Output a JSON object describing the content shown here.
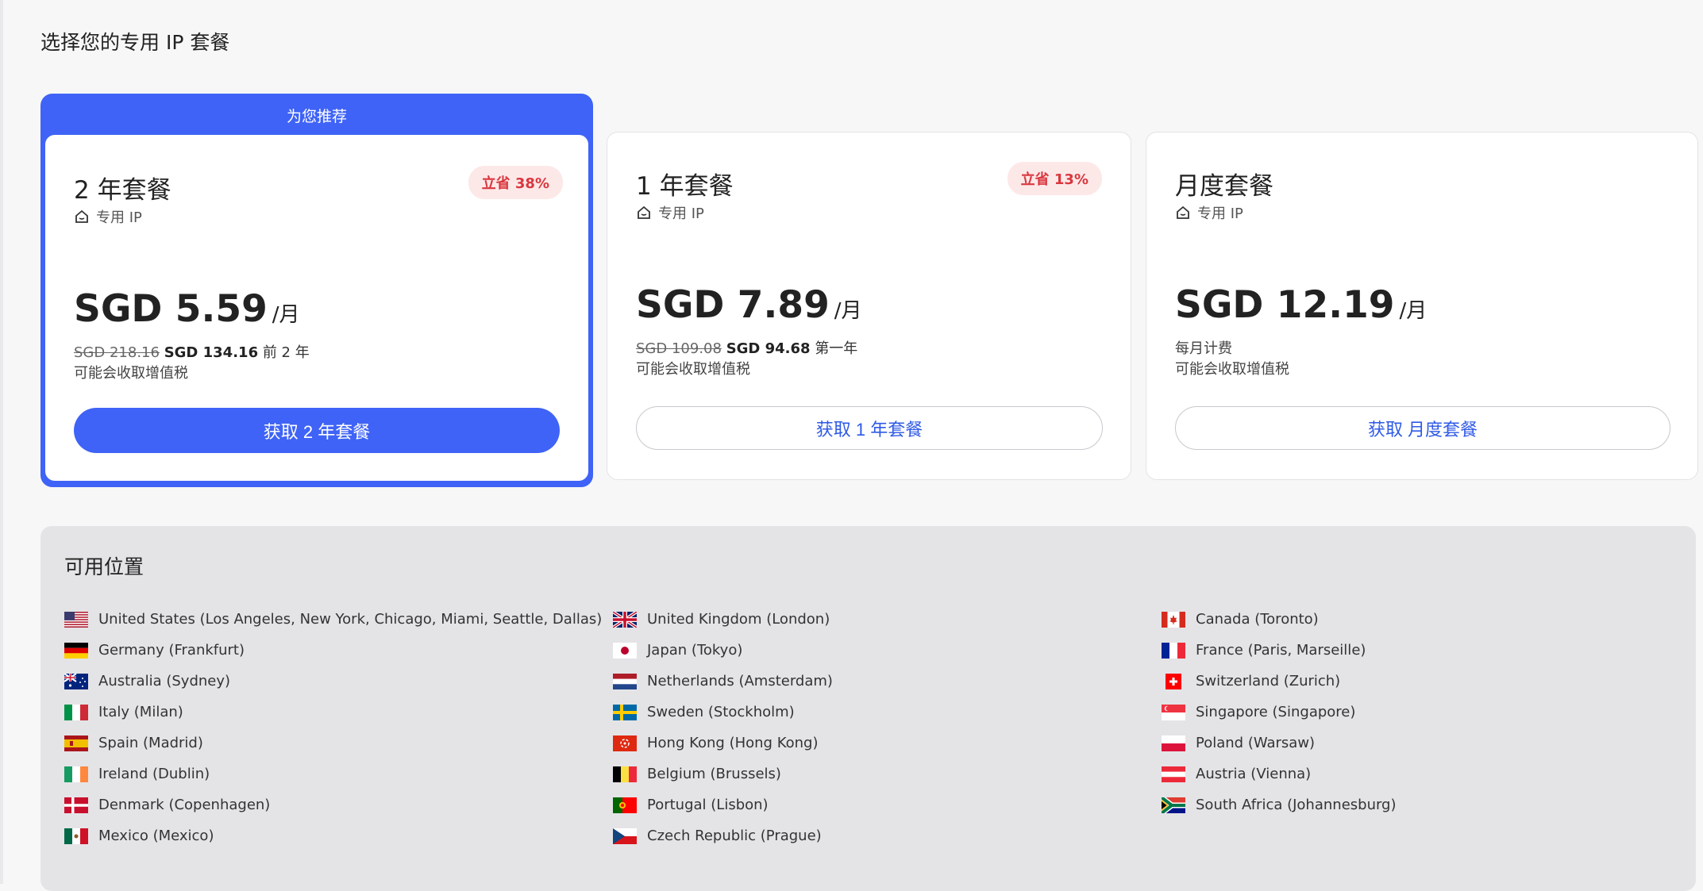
{
  "page": {
    "title": "选择您的专用 IP 套餐"
  },
  "plans": [
    {
      "recommended_label": "为您推荐",
      "name": "2 年套餐",
      "sub": "专用 IP",
      "badge": "立省 38%",
      "price": "SGD 5.59",
      "unit": "/月",
      "old_price": "SGD 218.16",
      "new_price": "SGD 134.16",
      "period_text": "前 2 年",
      "tax_note": "可能会收取增值税",
      "button": "获取 2 年套餐"
    },
    {
      "name": "1 年套餐",
      "sub": "专用 IP",
      "badge": "立省 13%",
      "price": "SGD 7.89",
      "unit": "/月",
      "old_price": "SGD 109.08",
      "new_price": "SGD 94.68",
      "period_text": "第一年",
      "tax_note": "可能会收取增值税",
      "button": "获取 1 年套餐"
    },
    {
      "name": "月度套餐",
      "sub": "专用 IP",
      "price": "SGD 12.19",
      "unit": "/月",
      "billing": "每月计费",
      "tax_note": "可能会收取增值税",
      "button": "获取 月度套餐"
    }
  ],
  "locations": {
    "title": "可用位置",
    "columns": [
      [
        {
          "flag": "us",
          "label": "United States (Los Angeles, New York, Chicago, Miami, Seattle, Dallas)"
        },
        {
          "flag": "de",
          "label": "Germany (Frankfurt)"
        },
        {
          "flag": "au",
          "label": "Australia (Sydney)"
        },
        {
          "flag": "it",
          "label": "Italy (Milan)"
        },
        {
          "flag": "es",
          "label": "Spain (Madrid)"
        },
        {
          "flag": "ie",
          "label": "Ireland (Dublin)"
        },
        {
          "flag": "dk",
          "label": "Denmark (Copenhagen)"
        },
        {
          "flag": "mx",
          "label": "Mexico (Mexico)"
        }
      ],
      [
        {
          "flag": "gb",
          "label": "United Kingdom (London)"
        },
        {
          "flag": "jp",
          "label": "Japan (Tokyo)"
        },
        {
          "flag": "nl",
          "label": "Netherlands (Amsterdam)"
        },
        {
          "flag": "se",
          "label": "Sweden (Stockholm)"
        },
        {
          "flag": "hk",
          "label": "Hong Kong (Hong Kong)"
        },
        {
          "flag": "be",
          "label": "Belgium (Brussels)"
        },
        {
          "flag": "pt",
          "label": "Portugal (Lisbon)"
        },
        {
          "flag": "cz",
          "label": "Czech Republic (Prague)"
        }
      ],
      [
        {
          "flag": "ca",
          "label": "Canada (Toronto)"
        },
        {
          "flag": "fr",
          "label": "France (Paris, Marseille)"
        },
        {
          "flag": "ch",
          "label": "Switzerland (Zurich)"
        },
        {
          "flag": "sg",
          "label": "Singapore (Singapore)"
        },
        {
          "flag": "pl",
          "label": "Poland (Warsaw)"
        },
        {
          "flag": "at",
          "label": "Austria (Vienna)"
        },
        {
          "flag": "za",
          "label": "South Africa (Johannesburg)"
        }
      ]
    ]
  },
  "colors": {
    "accent": "#3f63f6",
    "badge_text": "#d9383f",
    "badge_bg": "#fde8e8"
  }
}
